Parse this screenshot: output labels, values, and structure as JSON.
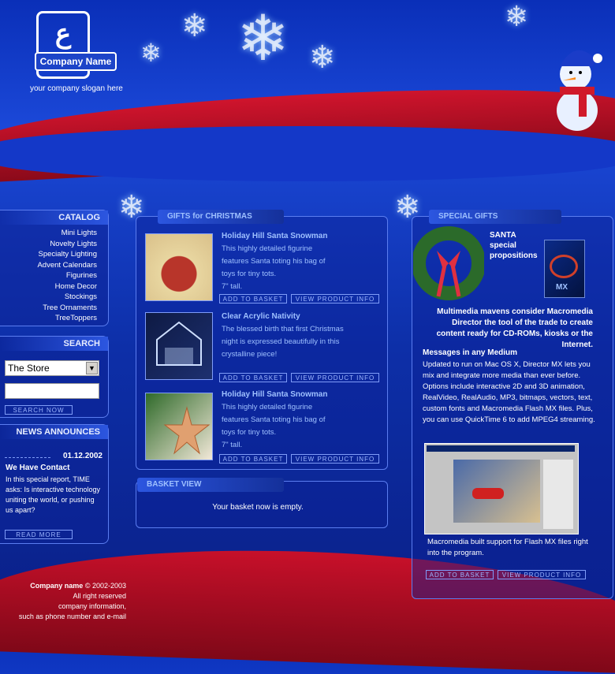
{
  "header": {
    "logo_mark": "ع",
    "company_name": "Company Name",
    "slogan": "your company slogan here"
  },
  "catalog": {
    "title": "CATALOG",
    "items": [
      "Mini Lights",
      "Novelty Lights",
      "Specialty Lighting",
      "Advent Calendars",
      "Figurines",
      "Home Decor",
      "Stockings",
      "Tree Ornaments",
      "TreeToppers"
    ]
  },
  "search": {
    "title": "SEARCH",
    "select_value": "The Store",
    "input_value": "",
    "button": "SEARCH NOW"
  },
  "news": {
    "title": "NEWS ANNOUNCES",
    "date": "01.12.2002",
    "headline": "We Have Contact",
    "body": "In this special report, TIME asks: Is interactive technology uniting the world, or pushing us apart?",
    "button": "READ MORE"
  },
  "gifts": {
    "title": "GIFTS for CHRISTMAS",
    "add_label": "ADD TO BASKET",
    "view_label": "VIEW PRODUCT INFO",
    "products": [
      {
        "title": "Holiday Hill Santa Snowman",
        "desc": "This highly detailed figurine features Santa toting his bag of toys for tiny tots.",
        "size": "7\" tall."
      },
      {
        "title": "Clear Acrylic Nativity",
        "desc": "The blessed birth that first Christmas night is expressed beautifully in this crystalline piece!",
        "size": ""
      },
      {
        "title": "Holiday Hill Santa Snowman",
        "desc": "This highly detailed figurine features Santa toting his bag of toys for tiny tots.",
        "size": "7\" tall."
      }
    ]
  },
  "basket": {
    "title": "BASKET VIEW",
    "message": "Your basket now is empty."
  },
  "special": {
    "title": "SPECIAL GIFTS",
    "santa_label": "SANTA special propositions",
    "box_label": "MX",
    "intro": "Multimedia mavens consider Macromedia Director the tool of the trade to create content ready for CD-ROMs, kiosks or the Internet.",
    "subtitle": "Messages in any Medium",
    "body": "Updated to run on Mac OS X, Director MX lets you mix and integrate more media than ever before. Options include interactive 2D and 3D animation, RealVideo, RealAudio, MP3, bitmaps, vectors, text, custom fonts and Macromedia Flash MX files. Plus, you can use QuickTime 6 to add MPEG4 streaming.",
    "caption": "Macromedia built support for Flash MX files right into the program.",
    "add_label": "ADD TO BASKET",
    "view_label": "VIEW PRODUCT INFO"
  },
  "footer": {
    "company": "Company name",
    "copyright": "© 2002-2003",
    "rights": "All right reserved",
    "info1": "company information,",
    "info2": "such as phone number and e-mail"
  }
}
